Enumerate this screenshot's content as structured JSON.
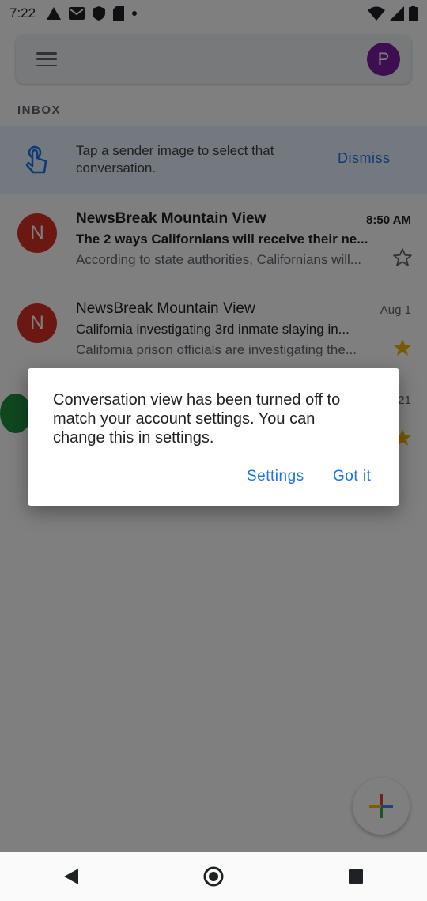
{
  "status_bar": {
    "time": "7:22"
  },
  "header": {
    "avatar_letter": "P"
  },
  "inbox_label": "INBOX",
  "tip": {
    "text": "Tap a sender image to select that conversation.",
    "dismiss_label": "Dismiss"
  },
  "emails": [
    {
      "avatar_letter": "N",
      "sender": "NewsBreak Mountain View",
      "subject": "The 2 ways Californians will receive their ne...",
      "snippet": "According to state authorities, Californians will...",
      "date": "8:50 AM",
      "starred": false,
      "unread": true
    },
    {
      "avatar_letter": "N",
      "sender": "NewsBreak Mountain View",
      "subject": "California investigating 3rd inmate slaying in...",
      "snippet": "California prison officials are investigating the...",
      "date": "Aug 1",
      "starred": true,
      "unread": false
    },
    {
      "avatar_letter": "",
      "sender": "",
      "subject": "",
      "snippet": "",
      "date": "21",
      "starred": true,
      "unread": false
    }
  ],
  "dialog": {
    "message": "Conversation view has been turned off to match your account settings. You can change this in settings.",
    "settings_label": "Settings",
    "gotit_label": "Got it"
  },
  "colors": {
    "accent": "#1a73e8",
    "avatar_red": "#d93025",
    "profile_purple": "#7b1fa2",
    "star": "#f4b400"
  }
}
